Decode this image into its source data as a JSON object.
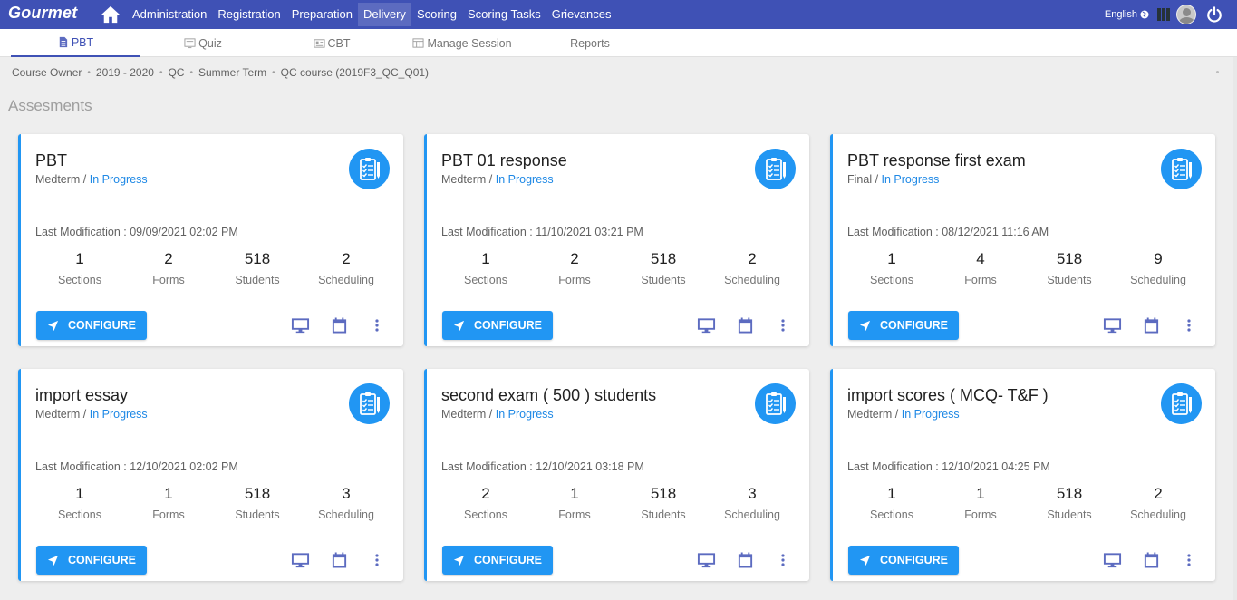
{
  "app": {
    "logo": "Gourmet"
  },
  "nav": {
    "items": [
      {
        "label": "Administration",
        "active": false
      },
      {
        "label": "Registration",
        "active": false
      },
      {
        "label": "Preparation",
        "active": false
      },
      {
        "label": "Delivery",
        "active": true
      },
      {
        "label": "Scoring",
        "active": false
      },
      {
        "label": "Scoring Tasks",
        "active": false
      },
      {
        "label": "Grievances",
        "active": false
      }
    ],
    "language": "English",
    "icons": [
      "home-icon",
      "globe-icon",
      "apps-icon",
      "avatar",
      "power-icon"
    ]
  },
  "tabs": [
    {
      "label": "PBT",
      "icon": "document-icon",
      "active": true
    },
    {
      "label": "Quiz",
      "icon": "quiz-icon",
      "active": false
    },
    {
      "label": "CBT",
      "icon": "cbt-icon",
      "active": false
    },
    {
      "label": "Manage Session",
      "icon": "session-icon",
      "active": false
    },
    {
      "label": "Reports",
      "icon": "",
      "active": false
    }
  ],
  "breadcrumb": [
    "Course Owner",
    "2019 - 2020",
    "QC",
    "Summer Term",
    "QC course (2019F3_QC_Q01)"
  ],
  "page_title": "Assesments",
  "labels": {
    "last_modification": "Last Modification : ",
    "sections": "Sections",
    "forms": "Forms",
    "students": "Students",
    "scheduling": "Scheduling",
    "configure": "CONFIGURE",
    "status_sep": " / "
  },
  "colors": {
    "primary": "#3f51b5",
    "accent": "#2196f3",
    "status": "#1e88e5"
  },
  "cards": [
    {
      "title": "PBT",
      "type": "Medterm",
      "status": "In Progress",
      "modified": "09/09/2021 02:02 PM",
      "sections": "1",
      "forms": "2",
      "students": "518",
      "scheduling": "2"
    },
    {
      "title": "PBT 01 response",
      "type": "Medterm",
      "status": "In Progress",
      "modified": "11/10/2021 03:21 PM",
      "sections": "1",
      "forms": "2",
      "students": "518",
      "scheduling": "2"
    },
    {
      "title": "PBT response first exam",
      "type": "Final",
      "status": "In Progress",
      "modified": "08/12/2021 11:16 AM",
      "sections": "1",
      "forms": "4",
      "students": "518",
      "scheduling": "9"
    },
    {
      "title": "import essay",
      "type": "Medterm",
      "status": "In Progress",
      "modified": "12/10/2021 02:02 PM",
      "sections": "1",
      "forms": "1",
      "students": "518",
      "scheduling": "3"
    },
    {
      "title": "second exam ( 500 ) students",
      "type": "Medterm",
      "status": "In Progress",
      "modified": "12/10/2021 03:18 PM",
      "sections": "2",
      "forms": "1",
      "students": "518",
      "scheduling": "3"
    },
    {
      "title": "import scores ( MCQ- T&F )",
      "type": "Medterm",
      "status": "In Progress",
      "modified": "12/10/2021 04:25 PM",
      "sections": "1",
      "forms": "1",
      "students": "518",
      "scheduling": "2"
    }
  ]
}
